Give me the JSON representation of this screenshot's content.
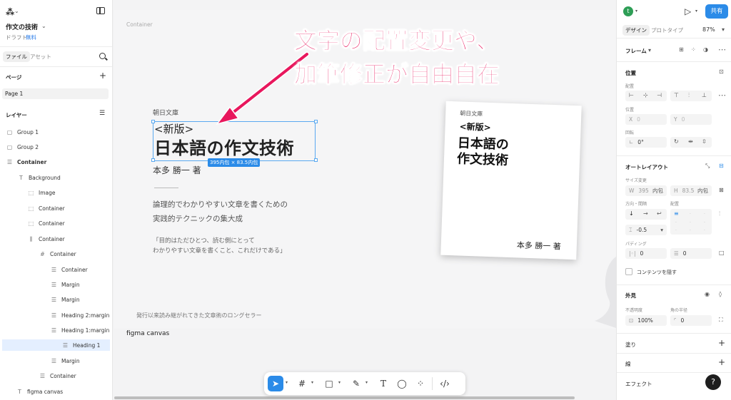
{
  "left_panel": {
    "file_title": "作文の技術",
    "draft_label": "ドラフト",
    "plan_badge": "無料",
    "tabs": {
      "file": "ファイル",
      "assets": "アセット"
    },
    "pages_title": "ページ",
    "page_item": "Page 1",
    "layers_title": "レイヤー",
    "layers": [
      {
        "label": "Group 1"
      },
      {
        "label": "Group 2"
      },
      {
        "label": "Container"
      },
      {
        "label": "Background"
      },
      {
        "label": "Image"
      },
      {
        "label": "Container"
      },
      {
        "label": "Container"
      },
      {
        "label": "Container"
      },
      {
        "label": "Container"
      },
      {
        "label": "Container"
      },
      {
        "label": "Margin"
      },
      {
        "label": "Margin"
      },
      {
        "label": "Heading 2:margin"
      },
      {
        "label": "Heading 1:margin"
      },
      {
        "label": "Heading 1"
      },
      {
        "label": "Margin"
      },
      {
        "label": "Container"
      },
      {
        "label": "figma canvas"
      }
    ]
  },
  "canvas": {
    "frame_label": "Container",
    "publisher": "朝日文庫",
    "title_small": "<新版>",
    "title_main": "日本語の作文技術",
    "dimension_badge": "395内包 × 83.5内包",
    "author": "本多 勝一 著",
    "description": [
      "論理的でわかりやすい文章を書くための",
      "実践的テクニックの集大成"
    ],
    "quote": [
      "「目的はただひとつ、読む側にとって",
      "わかりやすい文章を書くこと、これだけである」"
    ],
    "footer_text": "発行以来読み継がれてきた文章術のロングセラー",
    "annotation": [
      "文字の配置変更や、",
      "加筆修正が自由自在"
    ],
    "canvas_label": "figma canvas",
    "book": {
      "publisher": "朝日文庫",
      "subtitle": "<新版>",
      "title_lines": [
        "日本語の",
        "作文技術"
      ],
      "author": "本多 勝一 著"
    }
  },
  "right_panel": {
    "avatar": "t",
    "share_label": "共有",
    "tabs": {
      "design": "デザイン",
      "prototype": "プロトタイプ"
    },
    "zoom": "87%",
    "frame_label": "フレーム",
    "position_title": "位置",
    "align_label": "配置",
    "pos_label": "位置",
    "x_prefix": "X",
    "x_value": "0",
    "y_prefix": "Y",
    "y_value": "0",
    "rotation_label": "回転",
    "rotation_value": "0°",
    "auto_layout_title": "オートレイアウト",
    "size_label": "サイズ変更",
    "w_prefix": "W",
    "w_value": "395",
    "w_mode": "内包",
    "h_prefix": "H",
    "h_value": "83.5",
    "h_mode": "内包",
    "direction_label": "方向・間隔",
    "alignment_label": "配置",
    "gap_value": "-0.5",
    "padding_label": "パディング",
    "padding_h": "0",
    "padding_v": "0",
    "clip_label": "コンテンツを隠す",
    "appearance_title": "外見",
    "opacity_label": "不透明度",
    "opacity_value": "100%",
    "radius_label": "角の半径",
    "radius_value": "0",
    "fill_title": "塗り",
    "stroke_title": "線",
    "effects_title": "エフェクト",
    "help": "?"
  },
  "colors": {
    "accent": "#2b8be8",
    "annotation": "#e8175d",
    "avatar": "#2e9e56"
  }
}
